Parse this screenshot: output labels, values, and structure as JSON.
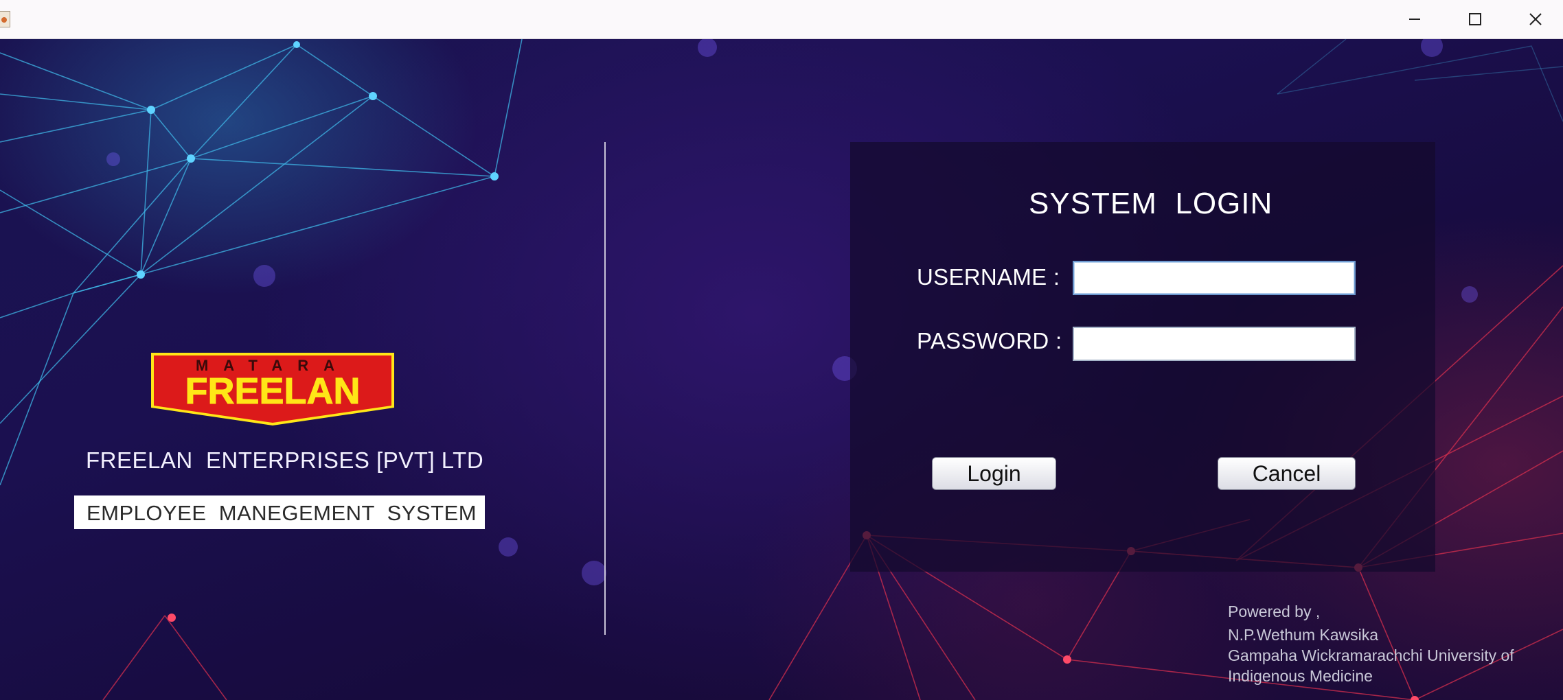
{
  "window": {
    "controls": {
      "minimize_icon": "minimize-icon",
      "maximize_icon": "maximize-icon",
      "close_icon": "close-icon"
    }
  },
  "brand": {
    "logo_top_text": "MATARA",
    "logo_main_text": "FREELAN",
    "company_name": "FREELAN  ENTERPRISES [PVT] LTD",
    "system_name": "EMPLOYEE  MANEGEMENT  SYSTEM",
    "logo_colors": {
      "red": "#dc1a1a",
      "yellow": "#ffe617"
    }
  },
  "login": {
    "title": "SYSTEM  LOGIN",
    "username_label": "USERNAME :",
    "username_value": "",
    "password_label": "PASSWORD :",
    "password_value": "",
    "login_button": "Login",
    "cancel_button": "Cancel"
  },
  "credits": {
    "line1": "Powered by ,",
    "line2": "N.P.Wethum Kawsika",
    "line3": "Gampaha Wickramarachchi University of",
    "line4": "Indigenous Medicine"
  }
}
